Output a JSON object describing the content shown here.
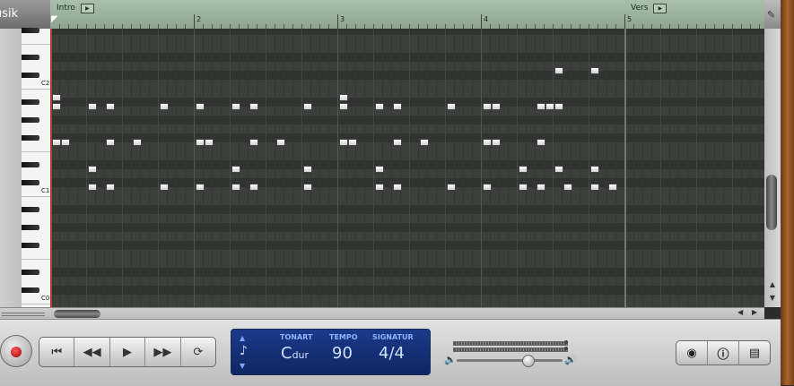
{
  "track": {
    "label": "usik"
  },
  "ruler": {
    "sections": [
      {
        "name": "Intro",
        "play_icon": "play-icon"
      },
      {
        "name": "Vers",
        "play_icon": "play-icon"
      }
    ],
    "bars": [
      "2",
      "3",
      "4",
      "5"
    ]
  },
  "piano": {
    "octave_labels": [
      "C2",
      "C1",
      "C0"
    ]
  },
  "lcd": {
    "key_label": "TONART",
    "key_value": "C",
    "key_suffix": "dur",
    "tempo_label": "TEMPO",
    "tempo_value": "90",
    "signature_label": "SIGNATUR",
    "signature_value": "4/4"
  },
  "transport": {
    "buttons": [
      "skip-to-start-icon",
      "rewind-icon",
      "play-icon",
      "fast-forward-icon",
      "cycle-icon"
    ]
  },
  "right_buttons": [
    "eye-icon",
    "info-icon",
    "media-browser-icon"
  ],
  "colors": {
    "lcd_background": "#1b3a8a",
    "ruler_green": "#a8bfa9",
    "record_red": "#c00000"
  },
  "notes": [
    [
      0,
      108
    ],
    [
      0,
      118
    ],
    [
      0,
      158
    ],
    [
      1,
      158
    ],
    [
      4,
      118
    ],
    [
      4,
      188
    ],
    [
      4,
      208
    ],
    [
      6,
      118
    ],
    [
      6,
      158
    ],
    [
      6,
      208
    ],
    [
      9,
      158
    ],
    [
      12,
      118
    ],
    [
      12,
      208
    ],
    [
      16,
      118
    ],
    [
      16,
      158
    ],
    [
      16,
      208
    ],
    [
      17,
      158
    ],
    [
      20,
      118
    ],
    [
      20,
      188
    ],
    [
      20,
      208
    ],
    [
      22,
      118
    ],
    [
      22,
      158
    ],
    [
      22,
      208
    ],
    [
      25,
      158
    ],
    [
      28,
      118
    ],
    [
      28,
      188
    ],
    [
      28,
      208
    ],
    [
      32,
      108
    ],
    [
      32,
      118
    ],
    [
      32,
      158
    ],
    [
      33,
      158
    ],
    [
      36,
      118
    ],
    [
      36,
      188
    ],
    [
      36,
      208
    ],
    [
      38,
      118
    ],
    [
      38,
      158
    ],
    [
      38,
      208
    ],
    [
      41,
      158
    ],
    [
      44,
      118
    ],
    [
      44,
      208
    ],
    [
      48,
      118
    ],
    [
      48,
      158
    ],
    [
      48,
      208
    ],
    [
      49,
      118
    ],
    [
      49,
      158
    ],
    [
      52,
      188
    ],
    [
      52,
      208
    ],
    [
      54,
      118
    ],
    [
      54,
      158
    ],
    [
      54,
      208
    ],
    [
      55,
      118
    ],
    [
      56,
      78
    ],
    [
      56,
      118
    ],
    [
      56,
      188
    ],
    [
      57,
      208
    ],
    [
      60,
      78
    ],
    [
      60,
      188
    ],
    [
      60,
      208
    ],
    [
      62,
      208
    ]
  ]
}
